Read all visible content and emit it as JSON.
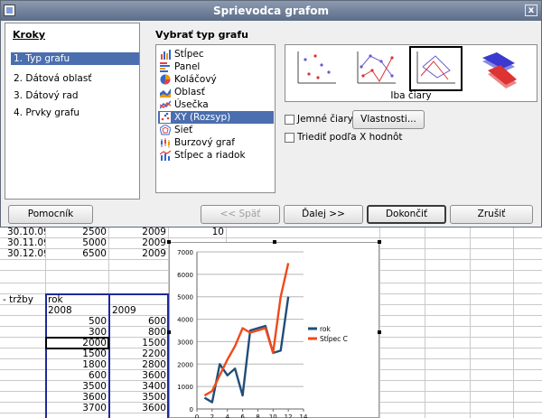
{
  "dialog": {
    "title": "Sprievodca grafom",
    "close_label": "x",
    "steps_title": "Kroky",
    "steps": [
      {
        "label": "1. Typ grafu",
        "active": true
      },
      {
        "label": "2. Dátová oblasť",
        "active": false
      },
      {
        "label": "3. Dátový rad",
        "active": false
      },
      {
        "label": "4. Prvky grafu",
        "active": false
      }
    ],
    "type_section_label": "Vybrať typ grafu",
    "chart_types": [
      {
        "label": "Stĺpec",
        "icon": "column-chart-icon",
        "active": false
      },
      {
        "label": "Panel",
        "icon": "bar-chart-icon",
        "active": false
      },
      {
        "label": "Koláčový",
        "icon": "pie-chart-icon",
        "active": false
      },
      {
        "label": "Oblasť",
        "icon": "area-chart-icon",
        "active": false
      },
      {
        "label": "Úsečka",
        "icon": "line-chart-icon",
        "active": false
      },
      {
        "label": "XY (Rozsyp)",
        "icon": "scatter-chart-icon",
        "active": true
      },
      {
        "label": "Sieť",
        "icon": "net-chart-icon",
        "active": false
      },
      {
        "label": "Burzový graf",
        "icon": "stock-chart-icon",
        "active": false
      },
      {
        "label": "Stĺpec a riadok",
        "icon": "column-line-chart-icon",
        "active": false
      }
    ],
    "variant_caption": "Iba čiary",
    "smooth_lines_label": "Jemné čiary",
    "properties_button": "Vlastnosti...",
    "sort_x_label": "Triediť podľa X hodnôt",
    "buttons": {
      "help": "Pomocník",
      "back": "<< Späť",
      "next": "Ďalej >>",
      "finish": "Dokončiť",
      "cancel": "Zrušiť"
    }
  },
  "sheet": {
    "rows_top": [
      {
        "date": "30.10.09",
        "b": "2500",
        "c": "2009",
        "d": "10"
      },
      {
        "date": "30.11.09",
        "b": "5000",
        "c": "2009",
        "d": ""
      },
      {
        "date": "30.12.09",
        "b": "6500",
        "c": "2009",
        "d": ""
      }
    ],
    "label_trzby": "- tržby",
    "label_rok": "rok",
    "year_2008": "2008",
    "year_2009": "2009",
    "data_rows": [
      [
        "500",
        "600"
      ],
      [
        "300",
        "800"
      ],
      [
        "2000",
        "1500"
      ],
      [
        "1500",
        "2200"
      ],
      [
        "1800",
        "2800"
      ],
      [
        "600",
        "3600"
      ],
      [
        "3500",
        "3400"
      ],
      [
        "3600",
        "3500"
      ],
      [
        "3700",
        "3600"
      ]
    ]
  },
  "chart_data": {
    "type": "line",
    "xlim": [
      0,
      14
    ],
    "ylim": [
      0,
      7000
    ],
    "xticks": [
      0,
      2,
      4,
      6,
      8,
      10,
      12,
      14
    ],
    "yticks": [
      0,
      1000,
      2000,
      3000,
      4000,
      5000,
      6000,
      7000
    ],
    "series": [
      {
        "name": "rok",
        "color": "#1f4e79",
        "x": [
          1,
          2,
          3,
          4,
          5,
          6,
          7,
          8,
          9,
          10,
          11,
          12
        ],
        "y": [
          500,
          300,
          2000,
          1500,
          1800,
          600,
          3500,
          3600,
          3700,
          2500,
          2600,
          5000
        ]
      },
      {
        "name": "Stĺpec C",
        "color": "#f04a1a",
        "x": [
          1,
          2,
          3,
          4,
          5,
          6,
          7,
          8,
          9,
          10,
          11,
          12
        ],
        "y": [
          600,
          800,
          1500,
          2200,
          2800,
          3600,
          3400,
          3500,
          3600,
          2500,
          5000,
          6500
        ]
      }
    ],
    "legend": "right"
  }
}
